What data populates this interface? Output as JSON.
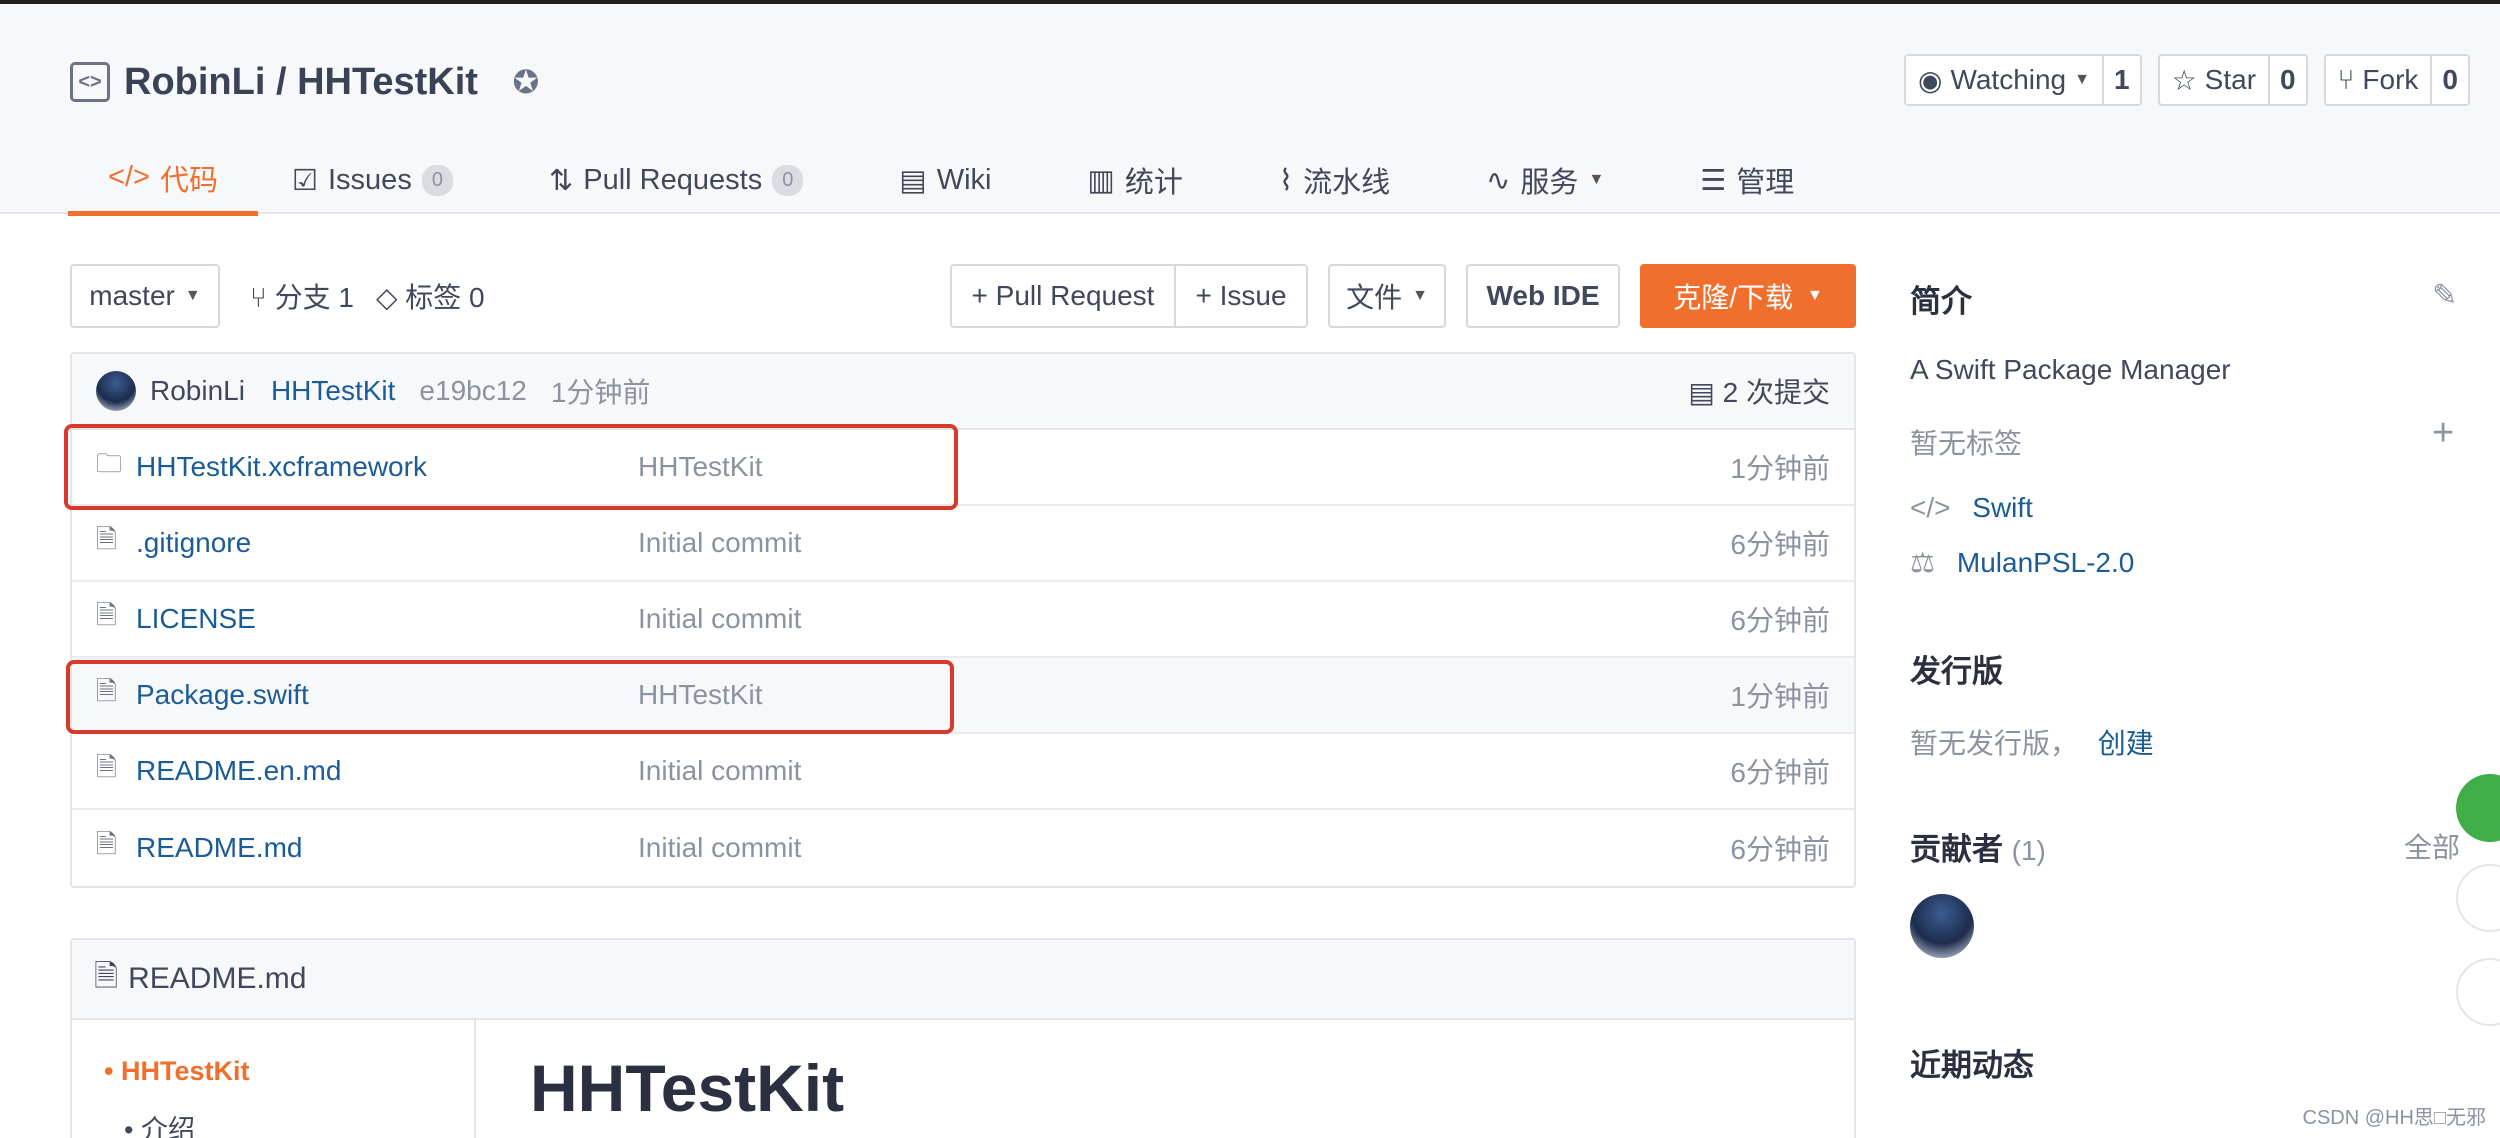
{
  "repo": {
    "owner": "RobinLi",
    "separator": " / ",
    "name": "HHTestKit"
  },
  "actions": [
    {
      "icon": "eye-icon",
      "label": "Watching",
      "count": "1"
    },
    {
      "icon": "star-icon",
      "label": "Star",
      "count": "0"
    },
    {
      "icon": "fork-icon",
      "label": "Fork",
      "count": "0"
    }
  ],
  "tabs": [
    {
      "icon": "code-icon",
      "label": "代码",
      "active": true
    },
    {
      "icon": "issues-icon",
      "label": "Issues",
      "count": "0"
    },
    {
      "icon": "pull-request-icon",
      "label": "Pull Requests",
      "count": "0"
    },
    {
      "icon": "wiki-icon",
      "label": "Wiki"
    },
    {
      "icon": "chart-icon",
      "label": "统计"
    },
    {
      "icon": "pipeline-icon",
      "label": "流水线"
    },
    {
      "icon": "pulse-icon",
      "label": "服务"
    },
    {
      "icon": "manage-icon",
      "label": "管理"
    }
  ],
  "toolbar": {
    "branch": "master",
    "branch_count": "分支 1",
    "tag_count": "标签 0",
    "pull_request": "+ Pull Request",
    "issue": "+ Issue",
    "file": "文件",
    "web_ide": "Web IDE",
    "clone": "克隆/下载"
  },
  "latest_commit": {
    "author": "RobinLi",
    "message": "HHTestKit",
    "hash": "e19bc12",
    "time": "1分钟前",
    "commits": "2 次提交"
  },
  "files": [
    {
      "type": "folder",
      "name": "HHTestKit.xcframework",
      "message": "HHTestKit",
      "time": "1分钟前"
    },
    {
      "type": "file",
      "name": ".gitignore",
      "message": "Initial commit",
      "time": "6分钟前"
    },
    {
      "type": "file",
      "name": "LICENSE",
      "message": "Initial commit",
      "time": "6分钟前"
    },
    {
      "type": "file",
      "name": "Package.swift",
      "message": "HHTestKit",
      "time": "1分钟前"
    },
    {
      "type": "file",
      "name": "README.en.md",
      "message": "Initial commit",
      "time": "6分钟前"
    },
    {
      "type": "file",
      "name": "README.md",
      "message": "Initial commit",
      "time": "6分钟前"
    }
  ],
  "readme": {
    "filename": "README.md",
    "toc": [
      "HHTestKit",
      "介绍"
    ],
    "heading": "HHTestKit"
  },
  "sidebar": {
    "intro_title": "简介",
    "description": "A Swift Package Manager",
    "no_tags": "暂无标签",
    "language": "Swift",
    "license": "MulanPSL-2.0",
    "releases_title": "发行版",
    "no_release": "暂无发行版，",
    "create": "创建",
    "contributors_title": "贡献者",
    "contributors_count": "(1)",
    "all": "全部",
    "activity_title": "近期动态"
  },
  "colors": {
    "accent": "#f16f2c",
    "link": "#1c5c96",
    "highlight": "#d9392a"
  },
  "watermark": "CSDN @HH思□无邪"
}
